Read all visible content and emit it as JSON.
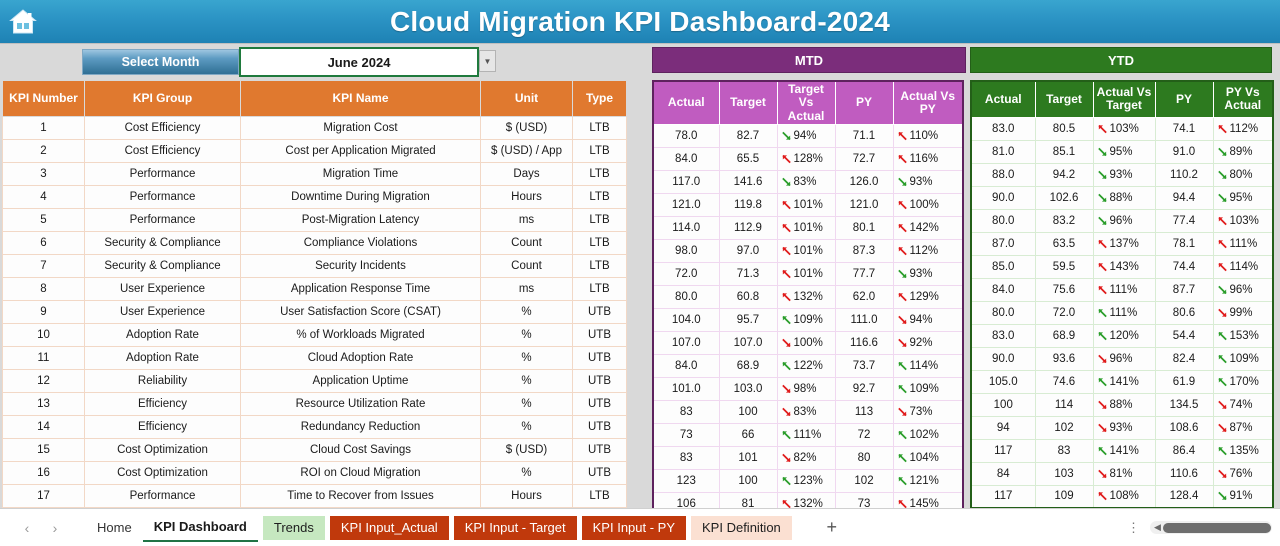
{
  "titlebar": {
    "home_icon": "home-icon",
    "title": "Cloud Migration KPI Dashboard-2024"
  },
  "controls": {
    "select_month_label": "Select Month",
    "month_value": "June 2024",
    "month_placeholder": "June 2024",
    "dropdown_icon": "chevron-down-icon",
    "mtd_group": "MTD",
    "ytd_group": "YTD"
  },
  "table": {
    "left_headers": [
      "KPI Number",
      "KPI Group",
      "KPI Name",
      "Unit",
      "Type"
    ],
    "mtd_headers": [
      "Actual",
      "Target",
      "Target Vs Actual",
      "PY",
      "Actual Vs PY"
    ],
    "ytd_headers": [
      "Actual",
      "Target",
      "Actual Vs Target",
      "PY",
      "PY Vs Actual"
    ],
    "rows": [
      {
        "num": "1",
        "group": "Cost Efficiency",
        "name": "Migration Cost",
        "unit": "$ (USD)",
        "type": "LTB",
        "mtd": {
          "actual": "78.0",
          "target": "82.7",
          "tva": "94%",
          "tva_arrow": "down-green",
          "py": "71.1",
          "avp": "110%",
          "avp_arrow": "up-red"
        },
        "ytd": {
          "actual": "83.0",
          "target": "80.5",
          "avt": "103%",
          "avt_arrow": "up-red",
          "py": "74.1",
          "pva": "112%",
          "pva_arrow": "up-red"
        }
      },
      {
        "num": "2",
        "group": "Cost Efficiency",
        "name": "Cost per Application Migrated",
        "unit": "$ (USD) / App",
        "type": "LTB",
        "mtd": {
          "actual": "84.0",
          "target": "65.5",
          "tva": "128%",
          "tva_arrow": "up-red",
          "py": "72.7",
          "avp": "116%",
          "avp_arrow": "up-red"
        },
        "ytd": {
          "actual": "81.0",
          "target": "85.1",
          "avt": "95%",
          "avt_arrow": "down-green",
          "py": "91.0",
          "pva": "89%",
          "pva_arrow": "down-green"
        }
      },
      {
        "num": "3",
        "group": "Performance",
        "name": "Migration Time",
        "unit": "Days",
        "type": "LTB",
        "mtd": {
          "actual": "117.0",
          "target": "141.6",
          "tva": "83%",
          "tva_arrow": "down-green",
          "py": "126.0",
          "avp": "93%",
          "avp_arrow": "down-green"
        },
        "ytd": {
          "actual": "88.0",
          "target": "94.2",
          "avt": "93%",
          "avt_arrow": "down-green",
          "py": "110.2",
          "pva": "80%",
          "pva_arrow": "down-green"
        }
      },
      {
        "num": "4",
        "group": "Performance",
        "name": "Downtime During Migration",
        "unit": "Hours",
        "type": "LTB",
        "mtd": {
          "actual": "121.0",
          "target": "119.8",
          "tva": "101%",
          "tva_arrow": "up-red",
          "py": "121.0",
          "avp": "100%",
          "avp_arrow": "up-red"
        },
        "ytd": {
          "actual": "90.0",
          "target": "102.6",
          "avt": "88%",
          "avt_arrow": "down-green",
          "py": "94.4",
          "pva": "95%",
          "pva_arrow": "down-green"
        }
      },
      {
        "num": "5",
        "group": "Performance",
        "name": "Post-Migration Latency",
        "unit": "ms",
        "type": "LTB",
        "mtd": {
          "actual": "114.0",
          "target": "112.9",
          "tva": "101%",
          "tva_arrow": "up-red",
          "py": "80.1",
          "avp": "142%",
          "avp_arrow": "up-red"
        },
        "ytd": {
          "actual": "80.0",
          "target": "83.2",
          "avt": "96%",
          "avt_arrow": "down-green",
          "py": "77.4",
          "pva": "103%",
          "pva_arrow": "up-red"
        }
      },
      {
        "num": "6",
        "group": "Security & Compliance",
        "name": "Compliance Violations",
        "unit": "Count",
        "type": "LTB",
        "mtd": {
          "actual": "98.0",
          "target": "97.0",
          "tva": "101%",
          "tva_arrow": "up-red",
          "py": "87.3",
          "avp": "112%",
          "avp_arrow": "up-red"
        },
        "ytd": {
          "actual": "87.0",
          "target": "63.5",
          "avt": "137%",
          "avt_arrow": "up-red",
          "py": "78.1",
          "pva": "111%",
          "pva_arrow": "up-red"
        }
      },
      {
        "num": "7",
        "group": "Security & Compliance",
        "name": "Security Incidents",
        "unit": "Count",
        "type": "LTB",
        "mtd": {
          "actual": "72.0",
          "target": "71.3",
          "tva": "101%",
          "tva_arrow": "up-red",
          "py": "77.7",
          "avp": "93%",
          "avp_arrow": "down-green"
        },
        "ytd": {
          "actual": "85.0",
          "target": "59.5",
          "avt": "143%",
          "avt_arrow": "up-red",
          "py": "74.4",
          "pva": "114%",
          "pva_arrow": "up-red"
        }
      },
      {
        "num": "8",
        "group": "User Experience",
        "name": "Application Response Time",
        "unit": "ms",
        "type": "LTB",
        "mtd": {
          "actual": "80.0",
          "target": "60.8",
          "tva": "132%",
          "tva_arrow": "up-red",
          "py": "62.0",
          "avp": "129%",
          "avp_arrow": "up-red"
        },
        "ytd": {
          "actual": "84.0",
          "target": "75.6",
          "avt": "111%",
          "avt_arrow": "up-red",
          "py": "87.7",
          "pva": "96%",
          "pva_arrow": "down-green"
        }
      },
      {
        "num": "9",
        "group": "User Experience",
        "name": "User Satisfaction Score (CSAT)",
        "unit": "%",
        "type": "UTB",
        "mtd": {
          "actual": "104.0",
          "target": "95.7",
          "tva": "109%",
          "tva_arrow": "up-green",
          "py": "111.0",
          "avp": "94%",
          "avp_arrow": "down-red"
        },
        "ytd": {
          "actual": "80.0",
          "target": "72.0",
          "avt": "111%",
          "avt_arrow": "up-green",
          "py": "80.6",
          "pva": "99%",
          "pva_arrow": "down-red"
        }
      },
      {
        "num": "10",
        "group": "Adoption Rate",
        "name": "% of Workloads Migrated",
        "unit": "%",
        "type": "UTB",
        "mtd": {
          "actual": "107.0",
          "target": "107.0",
          "tva": "100%",
          "tva_arrow": "down-red",
          "py": "116.6",
          "avp": "92%",
          "avp_arrow": "down-red"
        },
        "ytd": {
          "actual": "83.0",
          "target": "68.9",
          "avt": "120%",
          "avt_arrow": "up-green",
          "py": "54.4",
          "pva": "153%",
          "pva_arrow": "up-green"
        }
      },
      {
        "num": "11",
        "group": "Adoption Rate",
        "name": "Cloud Adoption Rate",
        "unit": "%",
        "type": "UTB",
        "mtd": {
          "actual": "84.0",
          "target": "68.9",
          "tva": "122%",
          "tva_arrow": "up-green",
          "py": "73.7",
          "avp": "114%",
          "avp_arrow": "up-green"
        },
        "ytd": {
          "actual": "90.0",
          "target": "93.6",
          "avt": "96%",
          "avt_arrow": "down-red",
          "py": "82.4",
          "pva": "109%",
          "pva_arrow": "up-green"
        }
      },
      {
        "num": "12",
        "group": "Reliability",
        "name": "Application Uptime",
        "unit": "%",
        "type": "UTB",
        "mtd": {
          "actual": "101.0",
          "target": "103.0",
          "tva": "98%",
          "tva_arrow": "down-red",
          "py": "92.7",
          "avp": "109%",
          "avp_arrow": "up-green"
        },
        "ytd": {
          "actual": "105.0",
          "target": "74.6",
          "avt": "141%",
          "avt_arrow": "up-green",
          "py": "61.9",
          "pva": "170%",
          "pva_arrow": "up-green"
        }
      },
      {
        "num": "13",
        "group": "Efficiency",
        "name": "Resource Utilization Rate",
        "unit": "%",
        "type": "UTB",
        "mtd": {
          "actual": "83",
          "target": "100",
          "tva": "83%",
          "tva_arrow": "down-red",
          "py": "113",
          "avp": "73%",
          "avp_arrow": "down-red"
        },
        "ytd": {
          "actual": "100",
          "target": "114",
          "avt": "88%",
          "avt_arrow": "down-red",
          "py": "134.5",
          "pva": "74%",
          "pva_arrow": "down-red"
        }
      },
      {
        "num": "14",
        "group": "Efficiency",
        "name": "Redundancy Reduction",
        "unit": "%",
        "type": "UTB",
        "mtd": {
          "actual": "73",
          "target": "66",
          "tva": "111%",
          "tva_arrow": "up-green",
          "py": "72",
          "avp": "102%",
          "avp_arrow": "up-green"
        },
        "ytd": {
          "actual": "94",
          "target": "102",
          "avt": "93%",
          "avt_arrow": "down-red",
          "py": "108.6",
          "pva": "87%",
          "pva_arrow": "down-red"
        }
      },
      {
        "num": "15",
        "group": "Cost Optimization",
        "name": "Cloud Cost Savings",
        "unit": "$ (USD)",
        "type": "UTB",
        "mtd": {
          "actual": "83",
          "target": "101",
          "tva": "82%",
          "tva_arrow": "down-red",
          "py": "80",
          "avp": "104%",
          "avp_arrow": "up-green"
        },
        "ytd": {
          "actual": "117",
          "target": "83",
          "avt": "141%",
          "avt_arrow": "up-green",
          "py": "86.4",
          "pva": "135%",
          "pva_arrow": "up-green"
        }
      },
      {
        "num": "16",
        "group": "Cost Optimization",
        "name": "ROI on Cloud Migration",
        "unit": "%",
        "type": "UTB",
        "mtd": {
          "actual": "123",
          "target": "100",
          "tva": "123%",
          "tva_arrow": "up-green",
          "py": "102",
          "avp": "121%",
          "avp_arrow": "up-green"
        },
        "ytd": {
          "actual": "84",
          "target": "103",
          "avt": "81%",
          "avt_arrow": "down-red",
          "py": "110.6",
          "pva": "76%",
          "pva_arrow": "down-red"
        }
      },
      {
        "num": "17",
        "group": "Performance",
        "name": "Time to Recover from Issues",
        "unit": "Hours",
        "type": "LTB",
        "mtd": {
          "actual": "106",
          "target": "81",
          "tva": "132%",
          "tva_arrow": "up-red",
          "py": "73",
          "avp": "145%",
          "avp_arrow": "up-red"
        },
        "ytd": {
          "actual": "117",
          "target": "109",
          "avt": "108%",
          "avt_arrow": "up-red",
          "py": "128.4",
          "pva": "91%",
          "pva_arrow": "down-green"
        }
      }
    ]
  },
  "tabbar": {
    "prev_icon": "chevron-left-icon",
    "next_icon": "chevron-right-icon",
    "tabs": [
      {
        "label": "Home",
        "style": "plain"
      },
      {
        "label": "KPI Dashboard",
        "style": "active"
      },
      {
        "label": "Trends",
        "style": "green"
      },
      {
        "label": "KPI Input_Actual",
        "style": "orange"
      },
      {
        "label": "KPI Input - Target",
        "style": "orange"
      },
      {
        "label": "KPI Input - PY",
        "style": "orange"
      },
      {
        "label": "KPI Definition",
        "style": "peach"
      }
    ],
    "add_label": "+",
    "kebab_icon": "more-options-icon",
    "scroll_icon": "horizontal-scrollbar"
  },
  "colors": {
    "title_bar": "#2b93c4",
    "left_header": "#e0792f",
    "mtd_group": "#7b2d7b",
    "mtd_header": "#c05cc0",
    "ytd": "#2d7a1f",
    "good": "#2a9d2a",
    "bad": "#e01b1b"
  }
}
